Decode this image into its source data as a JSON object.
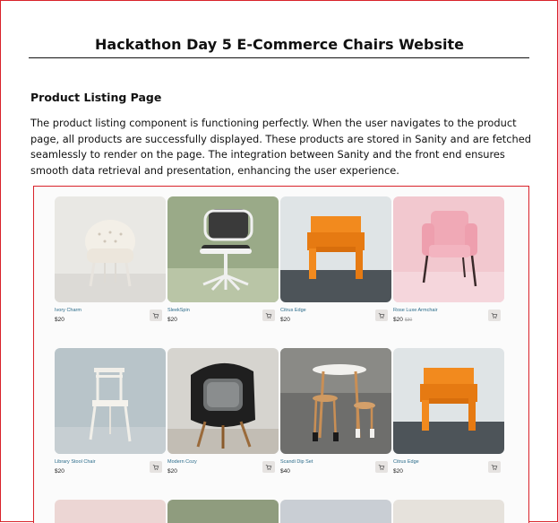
{
  "document": {
    "title": "Hackathon Day 5  E-Commerce Chairs Website",
    "section_heading": "Product Listing Page",
    "paragraph": "The product listing component is functioning perfectly. When the user navigates to the product page, all products are successfully displayed. These products are stored in Sanity and are fetched seamlessly to render on the page. The integration between Sanity and the front end ensures smooth data retrieval and presentation, enhancing the user experience."
  },
  "products": [
    {
      "name": "Ivory Charm",
      "price": "$20",
      "old_price": ""
    },
    {
      "name": "SleekSpin",
      "price": "$20",
      "old_price": ""
    },
    {
      "name": "Citrus Edge",
      "price": "$20",
      "old_price": ""
    },
    {
      "name": "Rose Luxe Armchair",
      "price": "$20",
      "old_price": "$30"
    },
    {
      "name": "Library Stool Chair",
      "price": "$20",
      "old_price": ""
    },
    {
      "name": "Modern Cozy",
      "price": "$20",
      "old_price": ""
    },
    {
      "name": "Scandi Dip Set",
      "price": "$40",
      "old_price": ""
    },
    {
      "name": "Citrus Edge",
      "price": "$20",
      "old_price": ""
    }
  ],
  "icons": {
    "cart": "cart-icon"
  },
  "colors": {
    "border_accent": "#d9232b",
    "product_name": "#2a6b8a",
    "chair_orange": "#f28a1e"
  }
}
